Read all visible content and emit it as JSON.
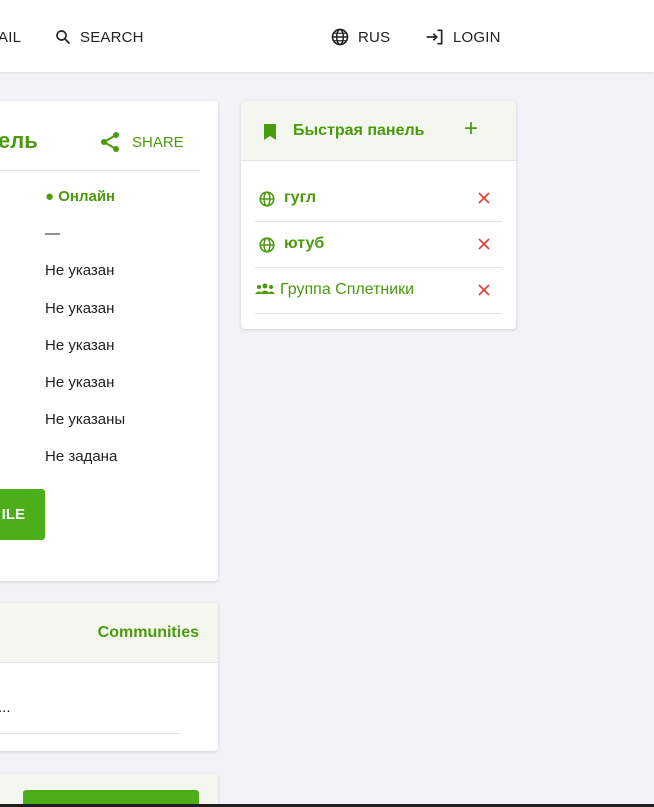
{
  "header": {
    "mail_label": "AIL",
    "search_label": "SEARCH",
    "lang_label": "RUS",
    "login_label": "LOGIN"
  },
  "profile": {
    "title_fragment": "ель",
    "share_label": "SHARE",
    "status": "● Онлайн",
    "values": [
      "—",
      "Не указан",
      "Не указан",
      "Не указан",
      "Не указан",
      "Не указаны",
      "Не задана"
    ],
    "edit_button_fragment": "ILE"
  },
  "communities": {
    "tab_label": "Communities",
    "ellipsis": "..."
  },
  "quick_panel": {
    "title": "Быстрая панель",
    "add_label": "+",
    "items": [
      {
        "label": "гугл",
        "icon": "globe-icon"
      },
      {
        "label": "ютуб",
        "icon": "globe-icon"
      },
      {
        "label": "Группа Сплетники",
        "icon": "group-icon"
      }
    ]
  },
  "colors": {
    "accent": "#4c9a0e",
    "button": "#4caf1a",
    "remove": "#e53935",
    "background": "#f1f3f6"
  }
}
